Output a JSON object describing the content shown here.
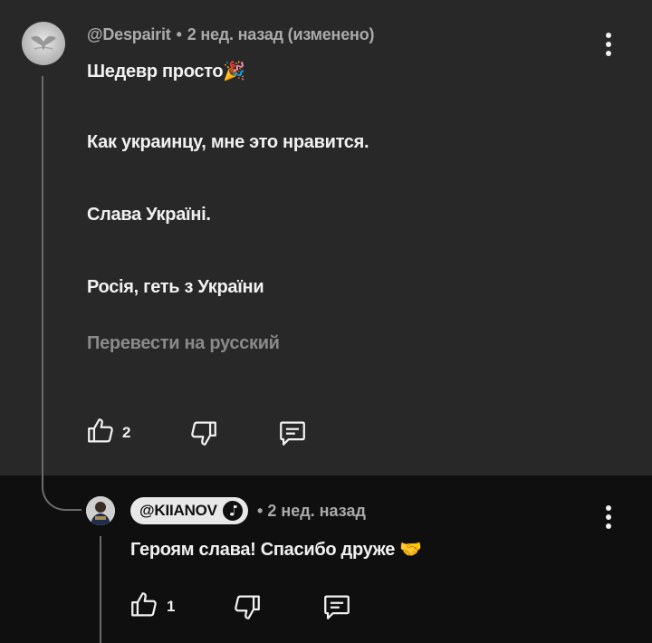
{
  "comment": {
    "author": "@Despairit",
    "separator": "•",
    "time": "2 нед. назад (изменено)",
    "lines": [
      "Шедевр просто",
      "Как украинцу, мне это нравится.",
      "Слава Україні.",
      "Росія, геть з України"
    ],
    "first_line_emoji": "🎉",
    "translate_label": "Перевести на русский",
    "likes": "2",
    "icons": {
      "like": "thumb-up-icon",
      "dislike": "thumb-down-icon",
      "reply": "reply-icon",
      "menu": "more-vert-icon"
    }
  },
  "reply": {
    "author": "@KIIANOV",
    "separator": "•",
    "time": "2 нед. назад",
    "text": "Героям слава! Спасибо друже",
    "emoji": "🤝",
    "likes": "1"
  },
  "colors": {
    "comment_bg": "#282828",
    "reply_bg": "#0f0f0f",
    "text": "#f1f1f1",
    "meta": "#aaaaaa",
    "translate": "#8a8a8a"
  }
}
